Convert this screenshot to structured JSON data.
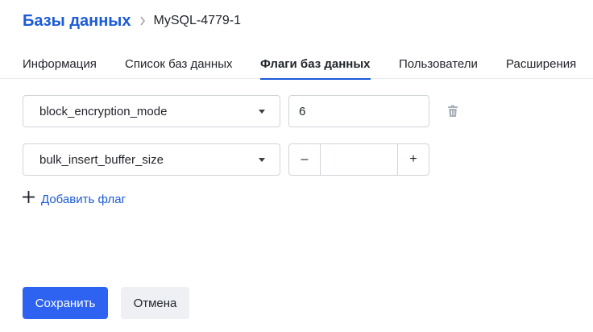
{
  "breadcrumb": {
    "title": "Базы данных",
    "current": "MySQL-4779-1"
  },
  "tabs": [
    {
      "label": "Информация",
      "active": false
    },
    {
      "label": "Список баз данных",
      "active": false
    },
    {
      "label": "Флаги баз данных",
      "active": true
    },
    {
      "label": "Пользователи",
      "active": false
    },
    {
      "label": "Расширения",
      "active": false
    }
  ],
  "flags": [
    {
      "name": "block_encryption_mode",
      "value": "6",
      "control": "text"
    },
    {
      "name": "bulk_insert_buffer_size",
      "value": "",
      "control": "stepper",
      "minus": "–",
      "plus": "+"
    }
  ],
  "add_flag_label": "Добавить флаг",
  "actions": {
    "save_label": "Сохранить",
    "cancel_label": "Отмена"
  },
  "colors": {
    "accent": "#1c5bd6",
    "primary_button": "#2d63f0"
  }
}
